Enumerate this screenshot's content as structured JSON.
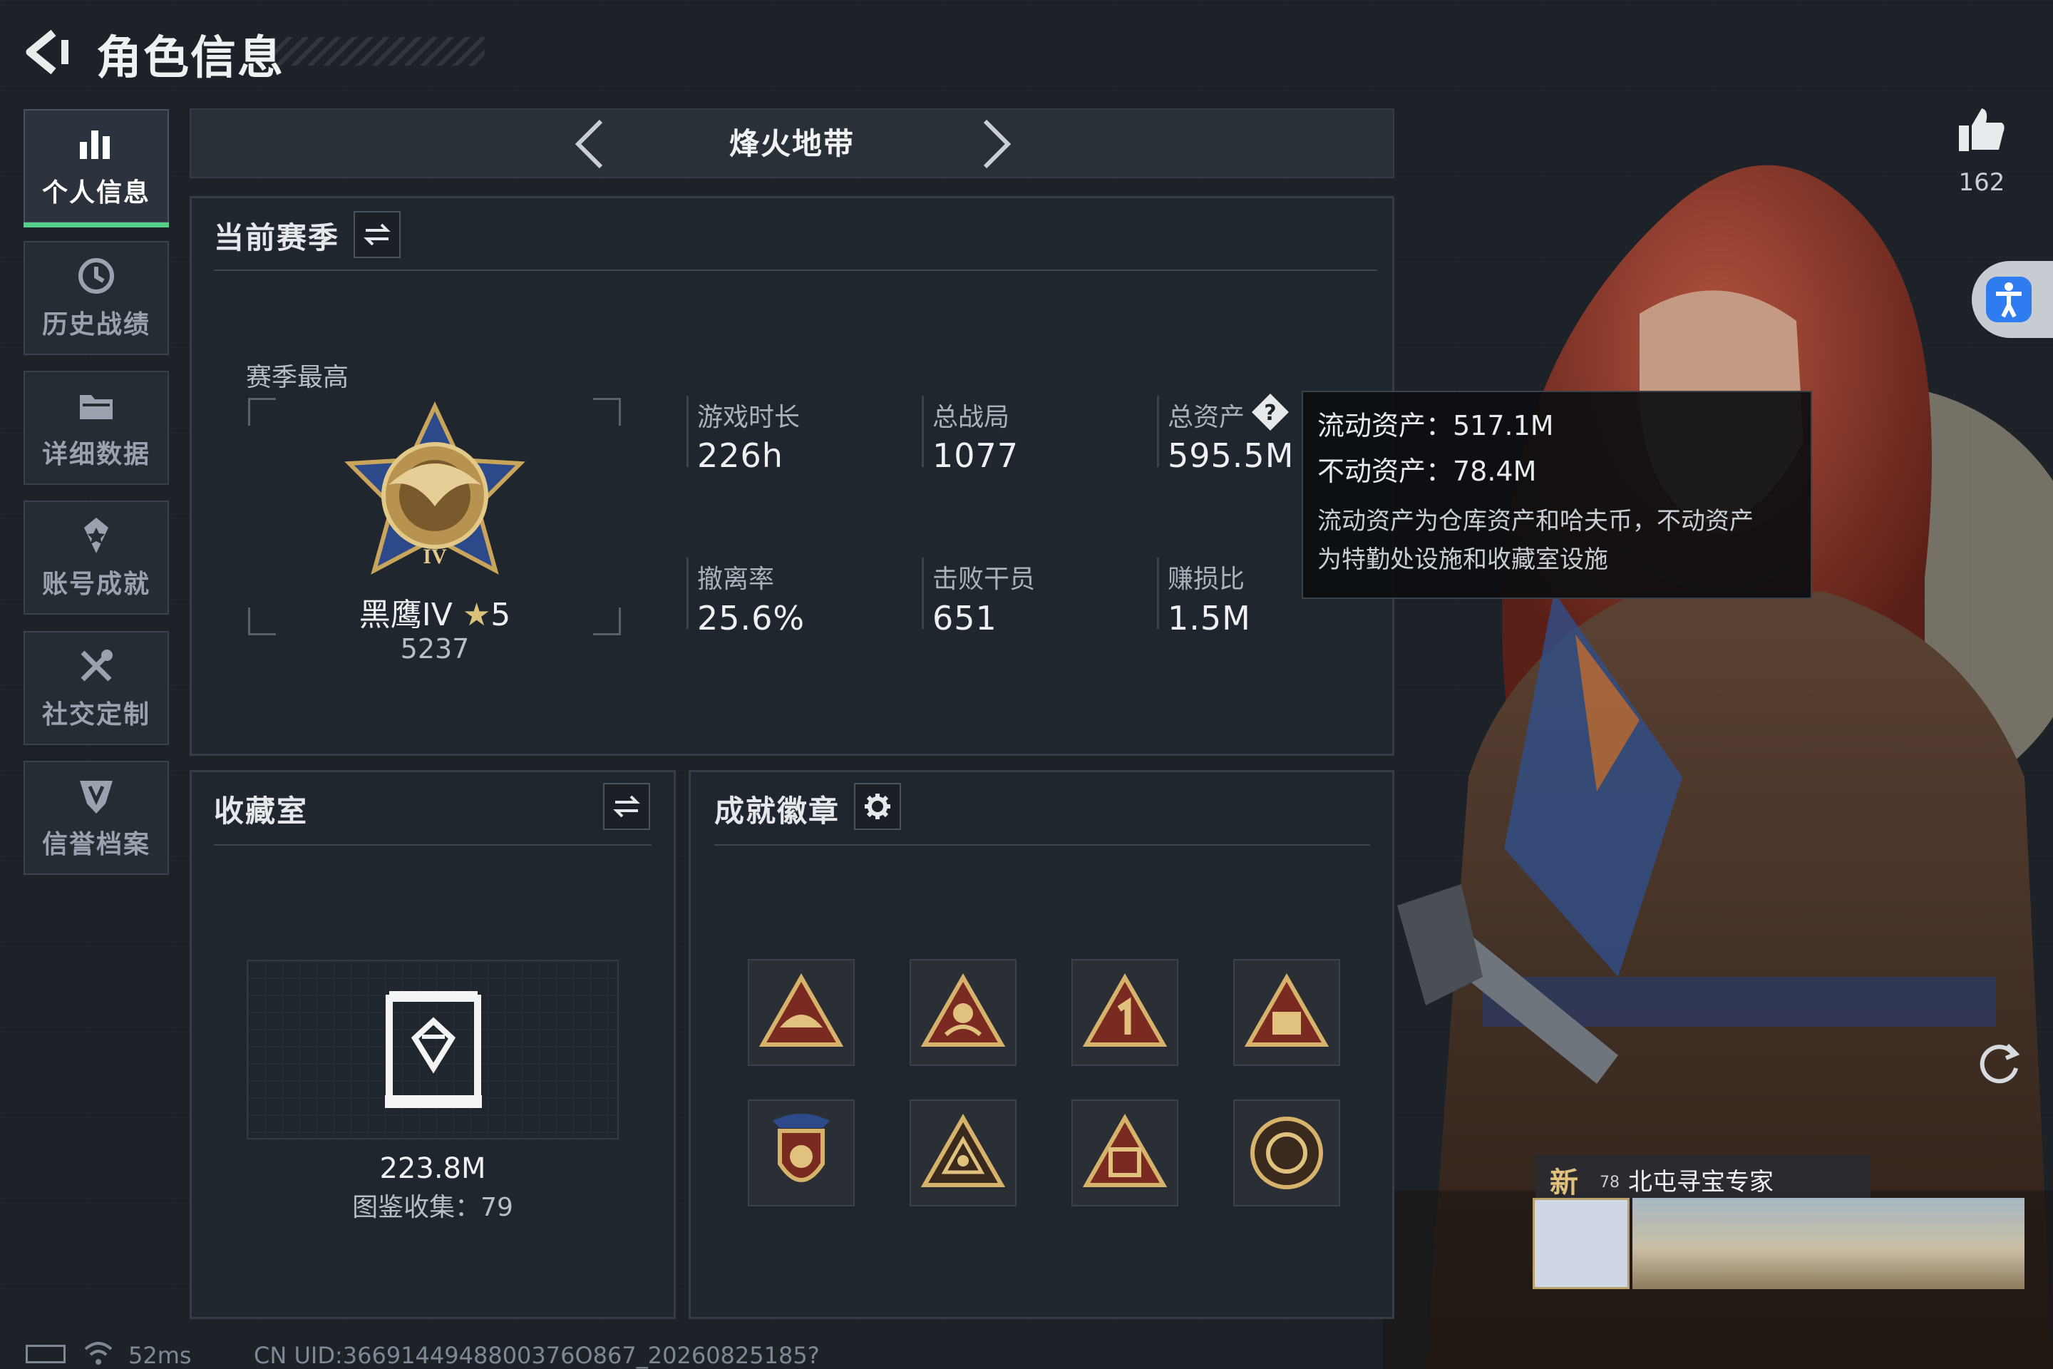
{
  "header": {
    "title": "角色信息"
  },
  "sidebar": {
    "items": [
      {
        "label": "个人信息",
        "icon": "bar-chart-icon",
        "active": true
      },
      {
        "label": "历史战绩",
        "icon": "history-clock-icon",
        "active": false
      },
      {
        "label": "详细数据",
        "icon": "folder-icon",
        "active": false
      },
      {
        "label": "账号成就",
        "icon": "achievement-star-icon",
        "active": false
      },
      {
        "label": "社交定制",
        "icon": "tools-icon",
        "active": false
      },
      {
        "label": "信誉档案",
        "icon": "shield-v-icon",
        "active": false
      }
    ]
  },
  "mode": {
    "title": "烽火地带"
  },
  "season": {
    "title": "当前赛季",
    "best_label": "赛季最高",
    "rank_name": "黑鹰IV",
    "rank_stars": "5",
    "rank_score": "5237",
    "stats": [
      {
        "label": "游戏时长",
        "value": "226h"
      },
      {
        "label": "总战局",
        "value": "1077"
      },
      {
        "label": "总资产",
        "value": "595.5M"
      },
      {
        "label": "撤离率",
        "value": "25.6%"
      },
      {
        "label": "击败干员",
        "value": "651"
      },
      {
        "label": "赚损比",
        "value": "1.5M"
      }
    ]
  },
  "tooltip": {
    "liquid": "流动资产：517.1M",
    "fixed": "不动资产：78.4M",
    "desc_line1": "流动资产为仓库资产和哈夫币，不动资产",
    "desc_line2": "为特勤处设施和收藏室设施"
  },
  "collection": {
    "title": "收藏室",
    "value": "223.8M",
    "catalog": "图鉴收集：79"
  },
  "achievements": {
    "title": "成就徽章",
    "badges": [
      "hat-badge-icon",
      "diver-badge-icon",
      "number-one-badge-icon",
      "armor-56-badge-icon",
      "medal-stars-badge-icon",
      "triangle-eye-badge-icon",
      "crate-badge-icon",
      "coin-badge-icon"
    ]
  },
  "likes": {
    "count": "162"
  },
  "card": {
    "level": "78",
    "nameplate": "北屯寻宝专家",
    "tag": "新"
  },
  "status_bar": {
    "ping": "52ms",
    "uid": "CN UID:3669144948800376O867_20260825185?"
  },
  "colors": {
    "accent_green": "#54d08a",
    "background": "#1d2229",
    "accessibility_blue": "#2f7cf0"
  }
}
